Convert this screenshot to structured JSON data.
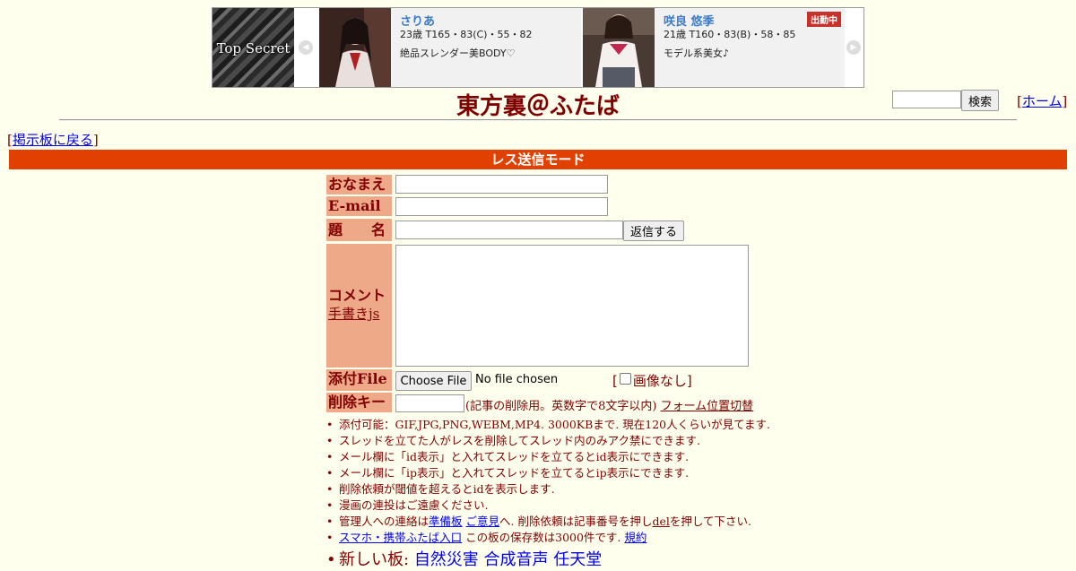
{
  "banner": {
    "logo_text": "Top Secret",
    "cards": [
      {
        "name": "さりあ",
        "stats": "23歳 T165・83(C)・55・82",
        "desc": "絶品スレンダー美BODY♡",
        "badge": ""
      },
      {
        "name": "咲良 悠季",
        "stats": "21歳 T160・83(B)・58・85",
        "desc": "モデル系美女♪",
        "badge": "出勤中"
      }
    ],
    "prev_arrow": "◀",
    "next_arrow": "▶"
  },
  "header": {
    "title": "東方裏＠ふたば",
    "search_button": "検索",
    "home_link": "ホーム",
    "bracket_open": "[",
    "bracket_close": "]"
  },
  "back_link": "掲示板に戻る",
  "mode_title": "レス送信モード",
  "form": {
    "name_label": "おなまえ",
    "email_label": "E-mail",
    "subject_label": "題　　名",
    "submit_button": "返信する",
    "comment_label": "コメント",
    "tegaki_link": "手書きjs",
    "file_label": "添付File",
    "choose_file_button": "Choose File",
    "no_file_text": "No file chosen",
    "no_image_label": "画像なし",
    "delkey_label": "削除キー",
    "delkey_note": "(記事の削除用。英数字で8文字以内)",
    "form_toggle_link": "フォーム位置切替"
  },
  "notes": {
    "n1": "添付可能：GIF,JPG,PNG,WEBM,MP4. 3000KBまで. 現在120人くらいが見てます.",
    "n2": "スレッドを立てた人がレスを削除してスレッド内のみアク禁にできます.",
    "n3": "メール欄に「id表示」と入れてスレッドを立てるとid表示にできます.",
    "n4": "メール欄に「ip表示」と入れてスレッドを立てるとip表示にできます.",
    "n5": "削除依頼が閾値を超えるとidを表示します.",
    "n6": "漫画の連投はご遠慮ください.",
    "n7_a": "管理人への連絡は",
    "n7_link1": "準備板",
    "n7_link2": "ご意見",
    "n7_b": "へ. 削除依頼は記事番号を押し",
    "n7_link3": "del",
    "n7_c": "を押して下さい.",
    "n8_link1": "スマホ・携帯ふたば入口",
    "n8_b": "この板の保存数は3000件です.",
    "n8_link2": "規約",
    "n9_label": "新しい板:",
    "n9_boards": [
      "自然災害",
      "合成音声",
      "任天堂"
    ]
  },
  "colors": {
    "background": "#ffffee",
    "text": "#800000",
    "mode_bar": "#e04000",
    "label_bg": "#eeaa88",
    "link": "#0000ee"
  }
}
